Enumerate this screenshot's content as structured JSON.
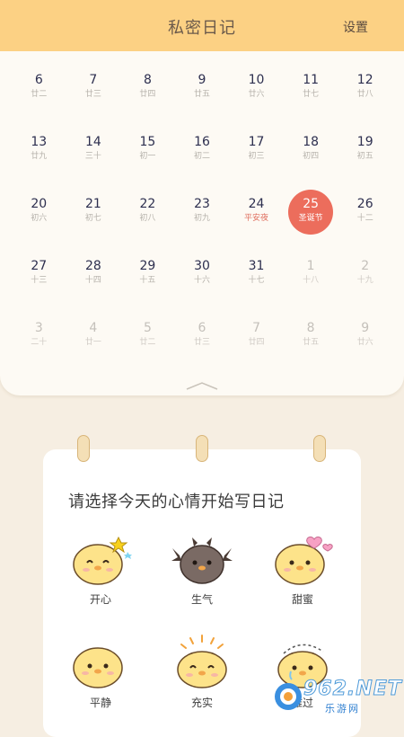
{
  "header": {
    "title": "私密日记",
    "settings_label": "设置"
  },
  "calendar": {
    "rows": [
      [
        {
          "d": "6",
          "l": "廿二"
        },
        {
          "d": "7",
          "l": "廿三"
        },
        {
          "d": "8",
          "l": "廿四"
        },
        {
          "d": "9",
          "l": "廿五"
        },
        {
          "d": "10",
          "l": "廿六"
        },
        {
          "d": "11",
          "l": "廿七"
        },
        {
          "d": "12",
          "l": "廿八"
        }
      ],
      [
        {
          "d": "13",
          "l": "廿九"
        },
        {
          "d": "14",
          "l": "三十"
        },
        {
          "d": "15",
          "l": "初一"
        },
        {
          "d": "16",
          "l": "初二"
        },
        {
          "d": "17",
          "l": "初三"
        },
        {
          "d": "18",
          "l": "初四"
        },
        {
          "d": "19",
          "l": "初五"
        }
      ],
      [
        {
          "d": "20",
          "l": "初六"
        },
        {
          "d": "21",
          "l": "初七"
        },
        {
          "d": "22",
          "l": "初八"
        },
        {
          "d": "23",
          "l": "初九"
        },
        {
          "d": "24",
          "l": "平安夜",
          "holiday": true
        },
        {
          "d": "25",
          "l": "圣诞节",
          "today": true
        },
        {
          "d": "26",
          "l": "十二"
        }
      ],
      [
        {
          "d": "27",
          "l": "十三"
        },
        {
          "d": "28",
          "l": "十四"
        },
        {
          "d": "29",
          "l": "十五"
        },
        {
          "d": "30",
          "l": "十六"
        },
        {
          "d": "31",
          "l": "十七"
        },
        {
          "d": "1",
          "l": "十八",
          "out": true
        },
        {
          "d": "2",
          "l": "十九",
          "out": true
        }
      ],
      [
        {
          "d": "3",
          "l": "二十",
          "out": true
        },
        {
          "d": "4",
          "l": "廿一",
          "out": true
        },
        {
          "d": "5",
          "l": "廿二",
          "out": true
        },
        {
          "d": "6",
          "l": "廿三",
          "out": true
        },
        {
          "d": "7",
          "l": "廿四",
          "out": true
        },
        {
          "d": "8",
          "l": "廿五",
          "out": true
        },
        {
          "d": "9",
          "l": "廿六",
          "out": true
        }
      ]
    ]
  },
  "mood_card": {
    "prompt": "请选择今天的心情开始写日记",
    "moods": [
      {
        "label": "开心",
        "icon": "happy-chick-icon"
      },
      {
        "label": "生气",
        "icon": "angry-chick-icon"
      },
      {
        "label": "甜蜜",
        "icon": "sweet-chick-icon"
      },
      {
        "label": "平静",
        "icon": "calm-chick-icon"
      },
      {
        "label": "充实",
        "icon": "fulfilled-chick-icon"
      },
      {
        "label": "难过",
        "icon": "sad-chick-icon"
      }
    ]
  },
  "watermark": {
    "text": "962.NET",
    "sub": "乐游网"
  },
  "colors": {
    "header": "#fcd184",
    "today": "#ec6d5c",
    "holiday": "#e07060",
    "chick": "#fde38a"
  }
}
